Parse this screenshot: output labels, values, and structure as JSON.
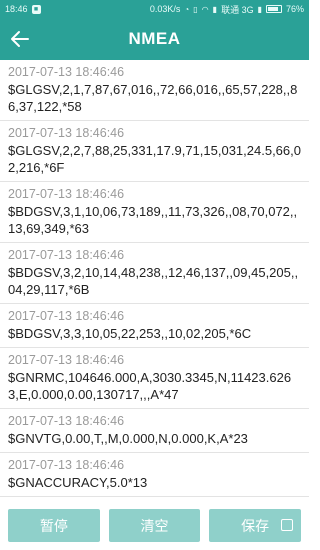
{
  "status": {
    "time": "18:46",
    "net_speed": "0.03K/s",
    "carrier": "联通 3G",
    "battery": "76%"
  },
  "appbar": {
    "title": "NMEA"
  },
  "log": [
    {
      "time": "2017-07-13 18:46:46",
      "sentence": "$GLGSV,2,1,7,87,67,016,,72,66,016,,65,57,228,,86,37,122,*58"
    },
    {
      "time": "2017-07-13 18:46:46",
      "sentence": "$GLGSV,2,2,7,88,25,331,17.9,71,15,031,24.5,66,02,216,*6F"
    },
    {
      "time": "2017-07-13 18:46:46",
      "sentence": "$BDGSV,3,1,10,06,73,189,,11,73,326,,08,70,072,,13,69,349,*63"
    },
    {
      "time": "2017-07-13 18:46:46",
      "sentence": "$BDGSV,3,2,10,14,48,238,,12,46,137,,09,45,205,,04,29,117,*6B"
    },
    {
      "time": "2017-07-13 18:46:46",
      "sentence": "$BDGSV,3,3,10,05,22,253,,10,02,205,*6C"
    },
    {
      "time": "2017-07-13 18:46:46",
      "sentence": "$GNRMC,104646.000,A,3030.3345,N,11423.6263,E,0.000,0.00,130717,,,A*47"
    },
    {
      "time": "2017-07-13 18:46:46",
      "sentence": "$GNVTG,0.00,T,,M,0.000,N,0.000,K,A*23"
    },
    {
      "time": "2017-07-13 18:46:46",
      "sentence": "$GNACCURACY,5.0*13"
    }
  ],
  "buttons": {
    "pause": "暂停",
    "clear": "清空",
    "save": "保存"
  },
  "colors": {
    "primary": "#2aa197",
    "button": "#8fd0ca"
  }
}
